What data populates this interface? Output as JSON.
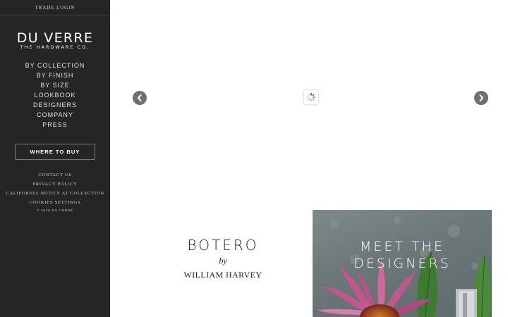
{
  "sidebar": {
    "trade_login": "TRADE LOGIN",
    "logo": {
      "main": "DU VERRE",
      "sub": "THE HARDWARE CO."
    },
    "nav": [
      {
        "label": "BY COLLECTION"
      },
      {
        "label": "BY FINISH"
      },
      {
        "label": "BY SIZE"
      },
      {
        "label": "LOOKBOOK"
      },
      {
        "label": "DESIGNERS"
      },
      {
        "label": "COMPANY"
      },
      {
        "label": "PRESS"
      }
    ],
    "where_to_buy": "WHERE TO BUY",
    "footer_links": [
      {
        "label": "CONTACT US"
      },
      {
        "label": "PRIVACY POLICY"
      },
      {
        "label": "CALIFORNIA NOTICE AT COLLECTION"
      },
      {
        "label": "COOKIES SETTINGS"
      }
    ],
    "copyright": "© 2026 DU VERRE"
  },
  "slider": {
    "prev_icon": "chevron-left-icon",
    "next_icon": "chevron-right-icon",
    "loading_icon": "spinner-icon"
  },
  "featured": {
    "title": "BOTERO",
    "by": "by",
    "designer": "WILLIAM HARVEY"
  },
  "designers_card": {
    "title_line1": "MEET THE",
    "title_line2": "DESIGNERS"
  },
  "colors": {
    "sidebar_bg": "#252525",
    "arrow_bg": "#6f6f6f"
  }
}
